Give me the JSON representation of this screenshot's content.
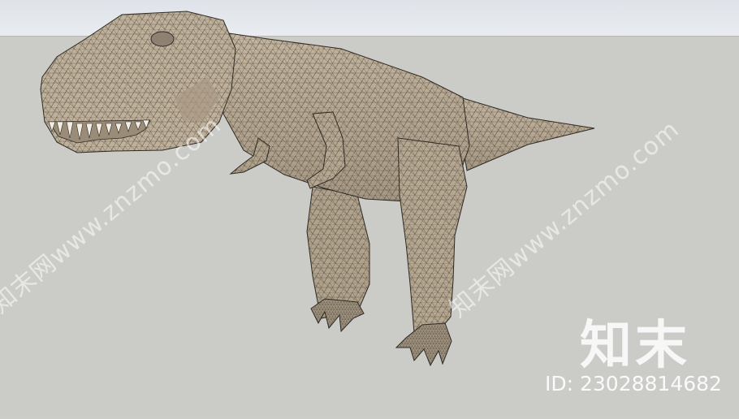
{
  "scene": {
    "subject_icon": "trex-wireframe-model",
    "sky_color": "#e6e9ee",
    "ground_color": "#cbcbc7",
    "model_color": "#b8a892",
    "wire_color": "#2e2a24"
  },
  "watermark": {
    "diagonal_text_left": "知末网www.znzmo.com",
    "diagonal_text_right": "知末网www.znzmo.com",
    "brand_logo": "知末",
    "asset_id": "ID: 2302881468​2"
  }
}
